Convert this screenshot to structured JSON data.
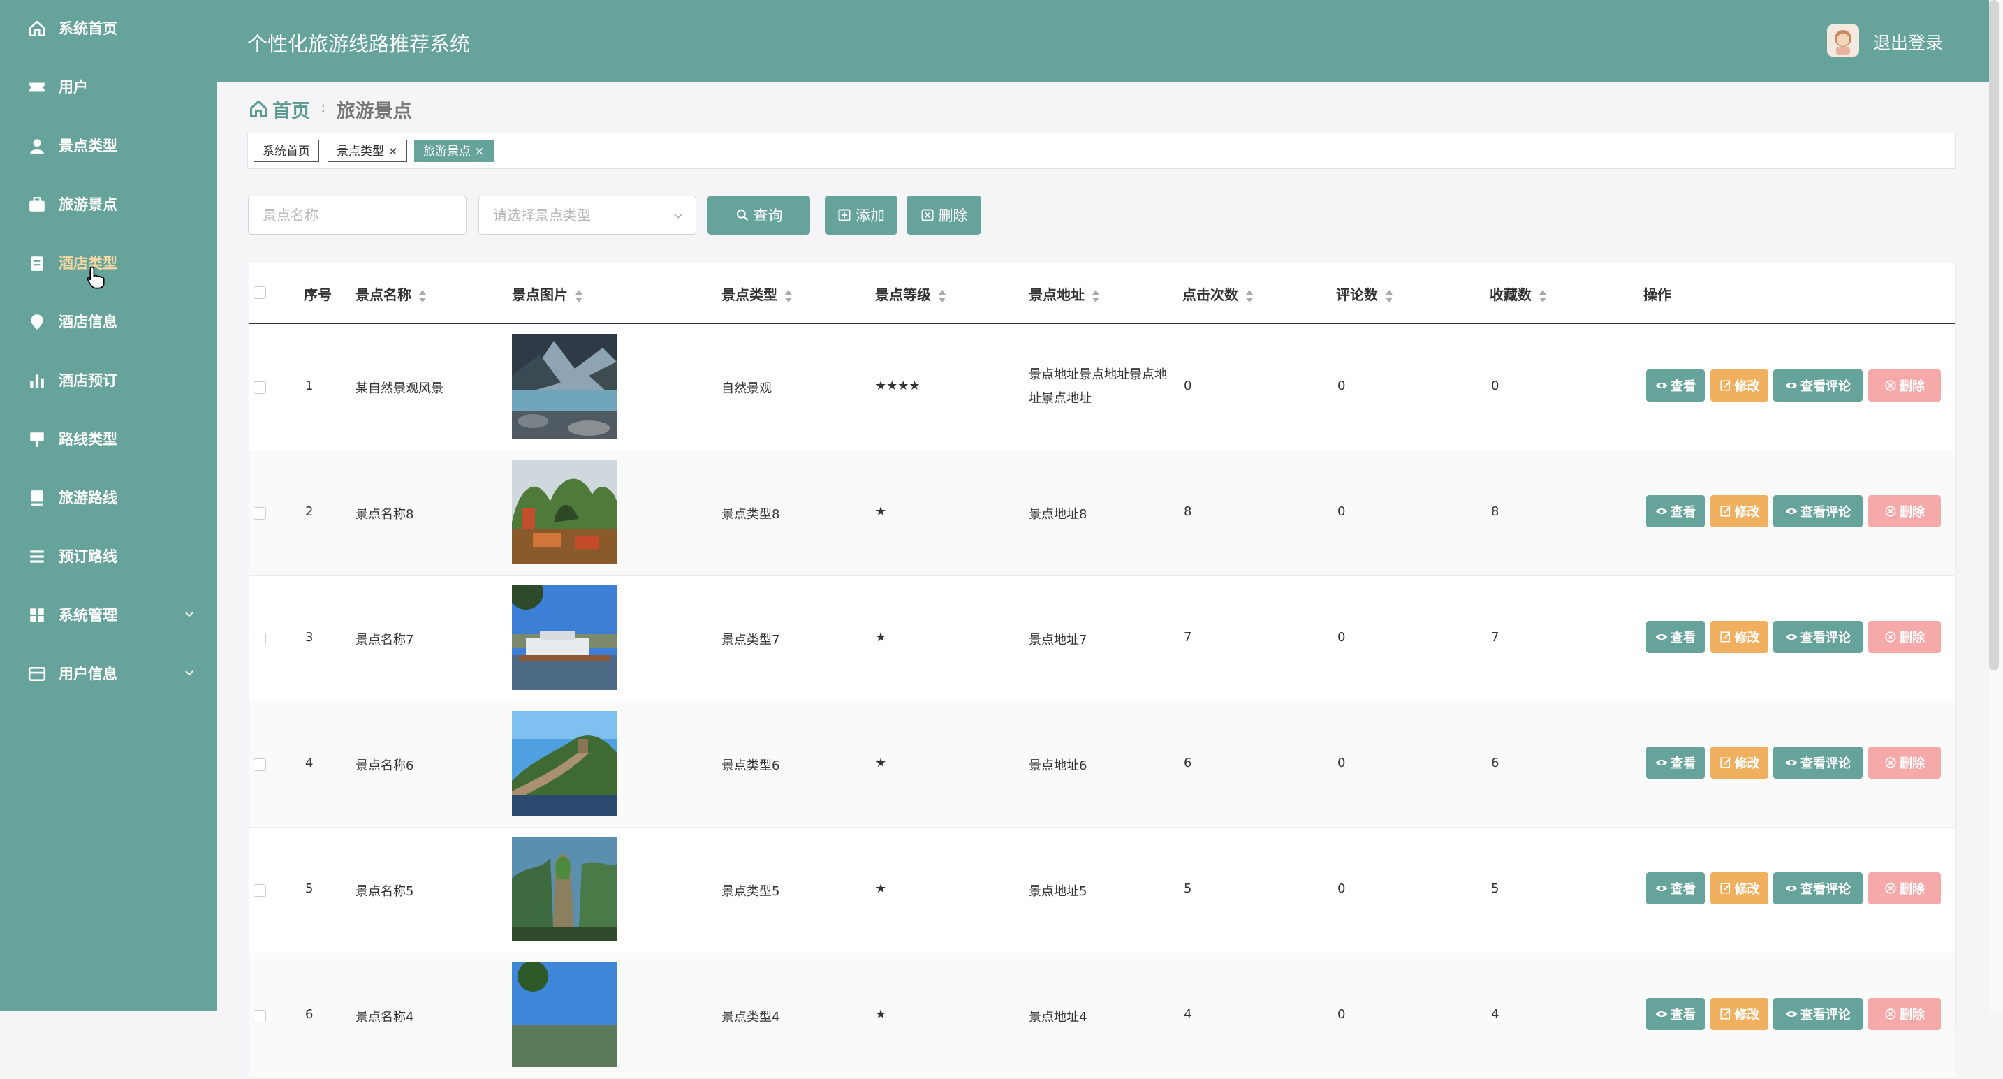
{
  "header": {
    "title": "个性化旅游线路推荐系统",
    "logout": "退出登录"
  },
  "sidebar": {
    "items": [
      {
        "label": "系统首页",
        "icon": "home-icon"
      },
      {
        "label": "用户",
        "icon": "ticket-icon"
      },
      {
        "label": "景点类型",
        "icon": "user-icon"
      },
      {
        "label": "旅游景点",
        "icon": "briefcase-icon"
      },
      {
        "label": "酒店类型",
        "icon": "clipboard-icon"
      },
      {
        "label": "酒店信息",
        "icon": "location-icon"
      },
      {
        "label": "酒店预订",
        "icon": "bar-chart-icon"
      },
      {
        "label": "路线类型",
        "icon": "sign-icon"
      },
      {
        "label": "旅游路线",
        "icon": "book-icon"
      },
      {
        "label": "预订路线",
        "icon": "list-icon"
      },
      {
        "label": "系统管理",
        "icon": "grid-icon"
      },
      {
        "label": "用户信息",
        "icon": "id-card-icon"
      }
    ]
  },
  "breadcrumb": {
    "home": "首页",
    "separator": "∶",
    "current": "旅游景点"
  },
  "tags": [
    {
      "label": "系统首页"
    },
    {
      "label": "景点类型 ×"
    },
    {
      "label": "旅游景点 ×"
    }
  ],
  "search": {
    "name_placeholder": "景点名称",
    "type_placeholder": "请选择景点类型",
    "query_label": "查询",
    "add_label": "添加",
    "delete_label": "删除"
  },
  "table": {
    "columns": {
      "index": "序号",
      "name": "景点名称",
      "image": "景点图片",
      "type": "景点类型",
      "level": "景点等级",
      "address": "景点地址",
      "clicks": "点击次数",
      "comments": "评论数",
      "favorites": "收藏数",
      "actions": "操作"
    },
    "rows": [
      {
        "index": "1",
        "name": "某自然景观风景",
        "type": "自然景观",
        "level": "★★★★",
        "address": "景点地址景点地址景点地址景点地址",
        "clicks": "0",
        "comments": "0",
        "favorites": "0"
      },
      {
        "index": "2",
        "name": "景点名称8",
        "type": "景点类型8",
        "level": "★",
        "address": "景点地址8",
        "clicks": "8",
        "comments": "0",
        "favorites": "8"
      },
      {
        "index": "3",
        "name": "景点名称7",
        "type": "景点类型7",
        "level": "★",
        "address": "景点地址7",
        "clicks": "7",
        "comments": "0",
        "favorites": "7"
      },
      {
        "index": "4",
        "name": "景点名称6",
        "type": "景点类型6",
        "level": "★",
        "address": "景点地址6",
        "clicks": "6",
        "comments": "0",
        "favorites": "6"
      },
      {
        "index": "5",
        "name": "景点名称5",
        "type": "景点类型5",
        "level": "★",
        "address": "景点地址5",
        "clicks": "5",
        "comments": "0",
        "favorites": "5"
      },
      {
        "index": "6",
        "name": "景点名称4",
        "type": "景点类型4",
        "level": "★",
        "address": "景点地址4",
        "clicks": "4",
        "comments": "0",
        "favorites": "4"
      }
    ],
    "action_labels": {
      "view": "查看",
      "edit": "修改",
      "comments": "查看评论",
      "delete": "删除"
    }
  },
  "colors": {
    "primary": "#66a39a",
    "edit": "#f0b060",
    "delete": "#f5a9a9",
    "active_menu": "#f7d9a3"
  }
}
